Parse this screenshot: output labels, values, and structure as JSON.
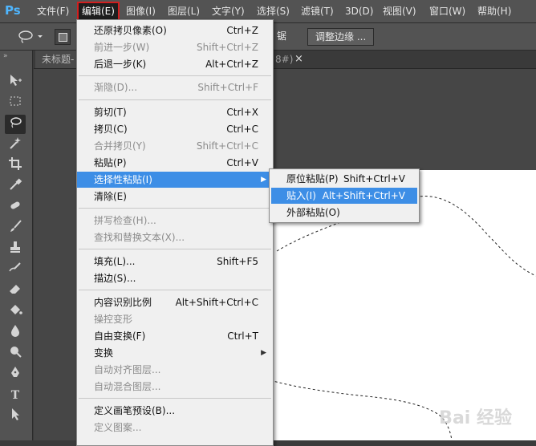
{
  "app": {
    "logo": "Ps"
  },
  "menubar": {
    "items": [
      {
        "label": "文件(F)"
      },
      {
        "label": "编辑(E)"
      },
      {
        "label": "图像(I)"
      },
      {
        "label": "图层(L)"
      },
      {
        "label": "文字(Y)"
      },
      {
        "label": "选择(S)"
      },
      {
        "label": "滤镜(T)"
      },
      {
        "label": "3D(D)"
      },
      {
        "label": "视图(V)"
      },
      {
        "label": "窗口(W)"
      },
      {
        "label": "帮助(H)"
      }
    ]
  },
  "options": {
    "partial_label": "锯齿",
    "refine_edge_label": "调整边缘 ..."
  },
  "tabs": {
    "doc_tab": "未标题-",
    "other_tab_suffix": "8#)",
    "close": "×"
  },
  "edit_menu": {
    "items": [
      {
        "label": "还原拷贝像素(O)",
        "shortcut": "Ctrl+Z"
      },
      {
        "label": "前进一步(W)",
        "shortcut": "Shift+Ctrl+Z"
      },
      {
        "label": "后退一步(K)",
        "shortcut": "Alt+Ctrl+Z"
      },
      {
        "label": "渐隐(D)...",
        "shortcut": "Shift+Ctrl+F"
      },
      {
        "label": "剪切(T)",
        "shortcut": "Ctrl+X"
      },
      {
        "label": "拷贝(C)",
        "shortcut": "Ctrl+C"
      },
      {
        "label": "合并拷贝(Y)",
        "shortcut": "Shift+Ctrl+C"
      },
      {
        "label": "粘贴(P)",
        "shortcut": "Ctrl+V"
      },
      {
        "label": "选择性粘贴(I)",
        "shortcut": ""
      },
      {
        "label": "清除(E)",
        "shortcut": ""
      },
      {
        "label": "拼写检查(H)...",
        "shortcut": ""
      },
      {
        "label": "查找和替换文本(X)...",
        "shortcut": ""
      },
      {
        "label": "填充(L)...",
        "shortcut": "Shift+F5"
      },
      {
        "label": "描边(S)...",
        "shortcut": ""
      },
      {
        "label": "内容识别比例",
        "shortcut": "Alt+Shift+Ctrl+C"
      },
      {
        "label": "操控变形",
        "shortcut": ""
      },
      {
        "label": "自由变换(F)",
        "shortcut": "Ctrl+T"
      },
      {
        "label": "变换",
        "shortcut": ""
      },
      {
        "label": "自动对齐图层...",
        "shortcut": ""
      },
      {
        "label": "自动混合图层...",
        "shortcut": ""
      },
      {
        "label": "定义画笔预设(B)...",
        "shortcut": ""
      },
      {
        "label": "定义图案...",
        "shortcut": ""
      }
    ]
  },
  "paste_special_menu": {
    "items": [
      {
        "label": "原位粘贴(P)",
        "shortcut": "Shift+Ctrl+V"
      },
      {
        "label": "贴入(I)",
        "shortcut": "Alt+Shift+Ctrl+V"
      },
      {
        "label": "外部粘贴(O)",
        "shortcut": ""
      }
    ]
  },
  "watermark": {
    "text": "Bai 经验"
  },
  "colors": {
    "menu_bg": "#535353",
    "dropdown_bg": "#f0f0f0",
    "highlight": "#3d8ee6",
    "active_outline": "#d21f1f"
  },
  "icons": {
    "toolbar": [
      "move-tool-icon",
      "marquee-tool-icon",
      "lasso-tool-icon",
      "magic-wand-icon",
      "crop-tool-icon",
      "eyedropper-icon",
      "healing-brush-icon",
      "brush-tool-icon",
      "clone-stamp-icon",
      "history-brush-icon",
      "eraser-tool-icon",
      "paint-bucket-icon",
      "blur-tool-icon",
      "dodge-tool-icon",
      "pen-tool-icon",
      "type-tool-icon",
      "path-selection-icon"
    ]
  }
}
